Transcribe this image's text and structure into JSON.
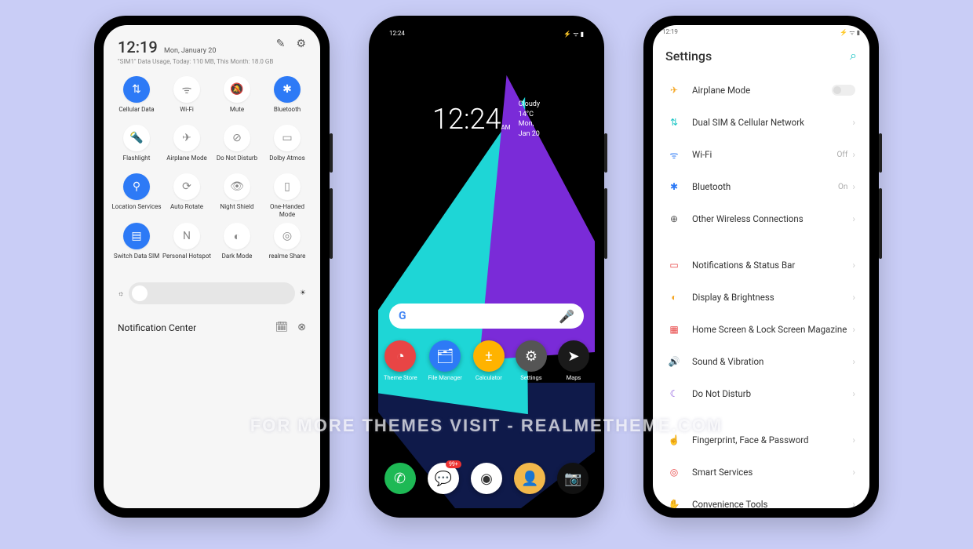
{
  "watermark": "FOR MORE THEMES VISIT - REALMETHEME.COM",
  "phone1": {
    "time": "12:19",
    "date": "Mon, January 20",
    "usage": "\"SIM1\" Data Usage, Today: 110 MB, This Month: 18.0 GB",
    "toggles": [
      {
        "label": "Cellular Data",
        "icon": "⇅",
        "active": true
      },
      {
        "label": "Wi-Fi",
        "icon": "ᯤ",
        "active": false
      },
      {
        "label": "Mute",
        "icon": "🔕",
        "active": false
      },
      {
        "label": "Bluetooth",
        "icon": "✱",
        "active": true
      },
      {
        "label": "Flashlight",
        "icon": "🔦",
        "active": false
      },
      {
        "label": "Airplane Mode",
        "icon": "✈",
        "active": false
      },
      {
        "label": "Do Not Disturb",
        "icon": "⊘",
        "active": false
      },
      {
        "label": "Dolby Atmos",
        "icon": "▭",
        "active": false
      },
      {
        "label": "Location Services",
        "icon": "⚲",
        "active": true
      },
      {
        "label": "Auto Rotate",
        "icon": "⟳",
        "active": false
      },
      {
        "label": "Night Shield",
        "icon": "👁",
        "active": false
      },
      {
        "label": "One-Handed Mode",
        "icon": "▯",
        "active": false
      },
      {
        "label": "Switch Data SIM",
        "icon": "▤",
        "active": true
      },
      {
        "label": "Personal Hotspot",
        "icon": "N",
        "active": false
      },
      {
        "label": "Dark Mode",
        "icon": "◐",
        "active": false
      },
      {
        "label": "realme Share",
        "icon": "◎",
        "active": false
      }
    ],
    "notif_title": "Notification Center"
  },
  "phone2": {
    "status_time": "12:24",
    "time": "12:24",
    "ampm": "AM",
    "weather": "Cloudy 14°C",
    "date": "Mon, Jan 20",
    "google": "G",
    "apps_row1": [
      {
        "label": "Theme Store",
        "bg": "#e84545",
        "icon": "◔"
      },
      {
        "label": "File Manager",
        "bg": "#2d7af6",
        "icon": "🗂"
      },
      {
        "label": "Calculator",
        "bg": "#ffb300",
        "icon": "±"
      },
      {
        "label": "Settings",
        "bg": "#555",
        "icon": "⚙"
      },
      {
        "label": "Maps",
        "bg": "#1a1a1a",
        "icon": "➤"
      }
    ],
    "apps_row2": [
      {
        "label": "",
        "bg": "#1eb955",
        "icon": "✆"
      },
      {
        "label": "",
        "bg": "#fff",
        "icon": "💬",
        "badge": "99+"
      },
      {
        "label": "",
        "bg": "#fff",
        "icon": "◉"
      },
      {
        "label": "",
        "bg": "#f2b84b",
        "icon": "👤"
      },
      {
        "label": "",
        "bg": "#111",
        "icon": "📷"
      }
    ]
  },
  "phone3": {
    "status_time": "12:19",
    "title": "Settings",
    "items": [
      {
        "icon": "✈",
        "color": "#f5a623",
        "label": "Airplane Mode",
        "toggle": true
      },
      {
        "icon": "⇅",
        "color": "#1ec6c6",
        "label": "Dual SIM & Cellular Network"
      },
      {
        "icon": "ᯤ",
        "color": "#2d7af6",
        "label": "Wi-Fi",
        "value": "Off"
      },
      {
        "icon": "✱",
        "color": "#2d7af6",
        "label": "Bluetooth",
        "value": "On"
      },
      {
        "icon": "⊕",
        "color": "#555",
        "label": "Other Wireless Connections"
      },
      {
        "gap": true
      },
      {
        "icon": "▭",
        "color": "#e84545",
        "label": "Notifications & Status Bar"
      },
      {
        "icon": "◐",
        "color": "#f5a623",
        "label": "Display & Brightness"
      },
      {
        "icon": "▦",
        "color": "#e84545",
        "label": "Home Screen & Lock Screen Magazine"
      },
      {
        "icon": "🔊",
        "color": "#1ec6c6",
        "label": "Sound & Vibration"
      },
      {
        "icon": "☾",
        "color": "#8855dd",
        "label": "Do Not Disturb"
      },
      {
        "gap": true
      },
      {
        "icon": "☝",
        "color": "#1ec6c6",
        "label": "Fingerprint, Face & Password"
      },
      {
        "icon": "◎",
        "color": "#e84545",
        "label": "Smart Services"
      },
      {
        "icon": "✋",
        "color": "#f5a623",
        "label": "Convenience Tools"
      }
    ]
  }
}
